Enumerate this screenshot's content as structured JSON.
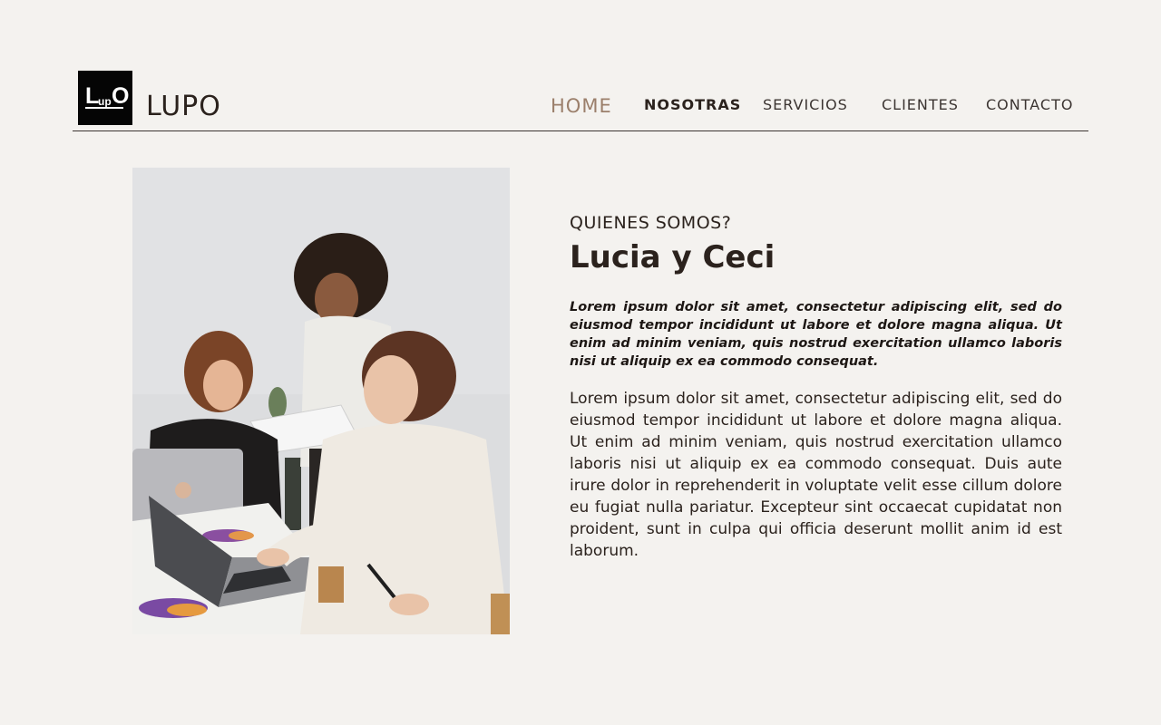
{
  "brand": {
    "logo_main": "L",
    "logo_sub": "up",
    "logo_end": "O",
    "name": "LUPO"
  },
  "nav": {
    "home": "HOME",
    "nosotras": "NOSOTRAS",
    "servicios": "SERVICIOS",
    "clientes": "CLIENTES",
    "contacto": "CONTACTO"
  },
  "about": {
    "eyebrow": "QUIENES SOMOS?",
    "title": "Lucia y Ceci",
    "lead": "Lorem ipsum dolor sit amet, consectetur adipiscing elit, sed do eiusmod tempor incididunt ut labore et dolore magna aliqua. Ut enim ad minim veniam, quis nostrud exercitation ullamco laboris nisi ut aliquip ex ea commodo consequat.",
    "body": "Lorem ipsum dolor sit amet, consectetur adipiscing elit, sed do eiusmod tempor incididunt ut labore et dolore magna aliqua. Ut enim ad minim veniam, quis nostrud exercitation ullamco laboris nisi ut aliquip ex ea commodo consequat. Duis aute irure dolor in reprehenderit in voluptate velit esse cillum dolore eu fugiat nulla pariatur. Excepteur sint occaecat cupidatat non proident, sunt in culpa qui officia deserunt mollit anim id est laborum."
  },
  "colors": {
    "background": "#f4f2ef",
    "text": "#2b221d",
    "accent_home": "#9b7f6b",
    "logo_bg": "#050505"
  }
}
